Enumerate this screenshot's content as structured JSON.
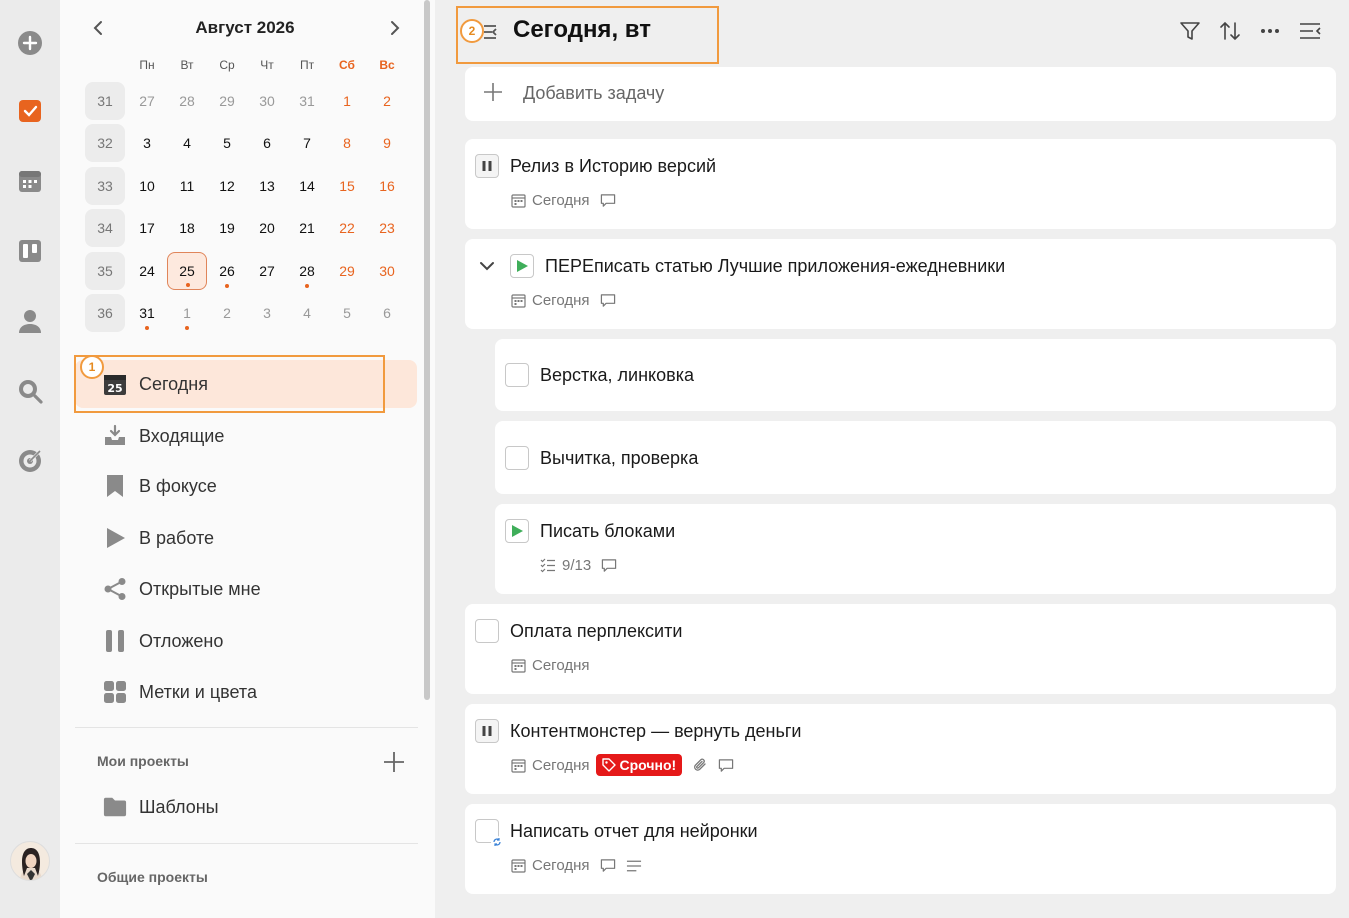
{
  "calendar": {
    "month_title": "Август 2026",
    "weekdays": [
      "Пн",
      "Вт",
      "Ср",
      "Чт",
      "Пт",
      "Сб",
      "Вс"
    ],
    "weeks": [
      {
        "num": "31",
        "days": [
          "27",
          "28",
          "29",
          "30",
          "31",
          "1",
          "2"
        ]
      },
      {
        "num": "32",
        "days": [
          "3",
          "4",
          "5",
          "6",
          "7",
          "8",
          "9"
        ]
      },
      {
        "num": "33",
        "days": [
          "10",
          "11",
          "12",
          "13",
          "14",
          "15",
          "16"
        ]
      },
      {
        "num": "34",
        "days": [
          "17",
          "18",
          "19",
          "20",
          "21",
          "22",
          "23"
        ]
      },
      {
        "num": "35",
        "days": [
          "24",
          "25",
          "26",
          "27",
          "28",
          "29",
          "30"
        ]
      },
      {
        "num": "36",
        "days": [
          "31",
          "1",
          "2",
          "3",
          "4",
          "5",
          "6"
        ]
      }
    ],
    "today": "25"
  },
  "sidebar": {
    "nav": [
      {
        "label": "Сегодня",
        "icon": "calendar-today-icon",
        "badge_text": "25"
      },
      {
        "label": "Входящие",
        "icon": "inbox-icon"
      },
      {
        "label": "В фокусе",
        "icon": "bookmark-icon"
      },
      {
        "label": "В работе",
        "icon": "play-icon"
      },
      {
        "label": "Открытые мне",
        "icon": "share-icon"
      },
      {
        "label": "Отложено",
        "icon": "pause-icon"
      },
      {
        "label": "Метки и цвета",
        "icon": "tags-icon"
      }
    ],
    "my_projects_title": "Мои проекты",
    "projects": [
      {
        "label": "Шаблоны",
        "icon": "folder-icon"
      }
    ],
    "shared_projects_title": "Общие проекты"
  },
  "annotations": {
    "badge1": "1",
    "badge2": "2"
  },
  "main": {
    "title": "Сегодня, вт",
    "add_task_label": "Добавить задачу",
    "tasks": [
      {
        "title": "Релиз в Историю версий",
        "date": "Сегодня"
      },
      {
        "title": "ПЕРЕписать статью Лучшие приложения-ежедневники",
        "date": "Сегодня"
      },
      {
        "title": "Верстка, линковка"
      },
      {
        "title": "Вычитка, проверка"
      },
      {
        "title": "Писать блоками",
        "checklist": "9/13"
      },
      {
        "title": "Оплата перплексити",
        "date": "Сегодня"
      },
      {
        "title": "Контентмонстер — вернуть деньги",
        "date": "Сегодня",
        "tag": "Срочно!"
      },
      {
        "title": "Написать отчет для нейронки",
        "date": "Сегодня"
      }
    ]
  },
  "colors": {
    "accent": "#e8641f",
    "urgent": "#e51919",
    "play": "#3fae5a",
    "highlight": "#f19a3e"
  }
}
